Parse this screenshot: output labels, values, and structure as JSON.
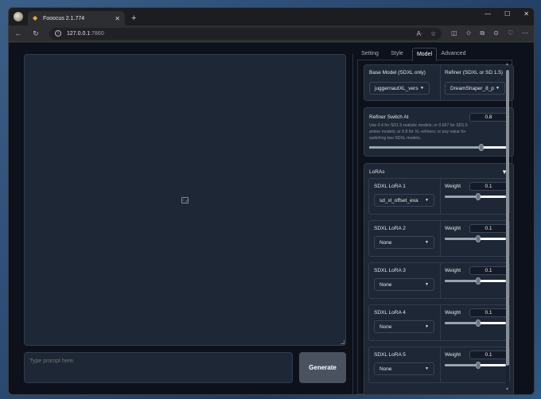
{
  "browser": {
    "tab_title": "Fooocus 2.1.774",
    "url_host": "127.0.0.1",
    "url_port": ":7860"
  },
  "prompt": {
    "placeholder": "Type prompt here."
  },
  "generate_label": "Generate",
  "tabs": [
    {
      "label": "Setting",
      "active": false
    },
    {
      "label": "Style",
      "active": false
    },
    {
      "label": "Model",
      "active": true
    },
    {
      "label": "Advanced",
      "active": false
    }
  ],
  "model": {
    "base_label": "Base Model (SDXL only)",
    "base_value": "juggernautXL_vers",
    "refiner_label": "Refiner (SDXL or SD 1.5)",
    "refiner_value": "DreamShaper_8_p",
    "switch_label": "Refiner Switch At",
    "switch_value": "0.8",
    "switch_fraction": 0.8,
    "switch_hint": "Use 0.4 for SD1.5 realistic models; or 0.667 for SD1.5 anime models; or 0.8 for XL-refiners; or any value for switching two SDXL models."
  },
  "loras": {
    "title": "LoRAs",
    "weight_label": "Weight",
    "items": [
      {
        "label": "SDXL LoRA 1",
        "value": "sd_xl_offset_exa",
        "weight": "0.1",
        "weight_fraction": 0.55
      },
      {
        "label": "SDXL LoRA 2",
        "value": "None",
        "weight": "0.1",
        "weight_fraction": 0.55
      },
      {
        "label": "SDXL LoRA 3",
        "value": "None",
        "weight": "0.1",
        "weight_fraction": 0.55
      },
      {
        "label": "SDXL LoRA 4",
        "value": "None",
        "weight": "0.1",
        "weight_fraction": 0.55
      },
      {
        "label": "SDXL LoRA 5",
        "value": "None",
        "weight": "0.1",
        "weight_fraction": 0.55
      }
    ]
  }
}
